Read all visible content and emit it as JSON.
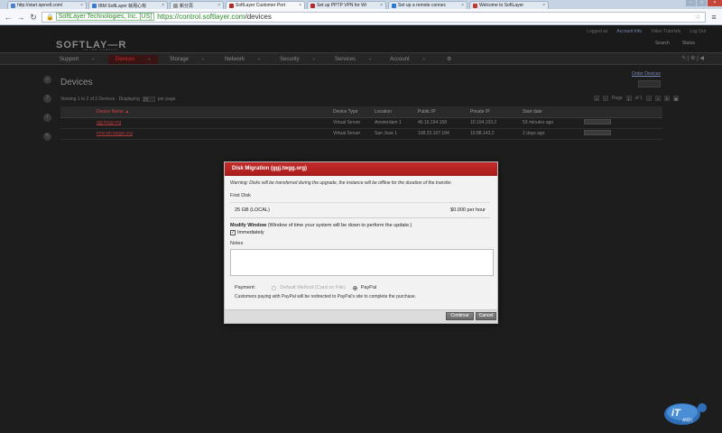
{
  "browser": {
    "tabs": [
      {
        "label": "http://start.iqonell.com/",
        "color": "#4f7fcf",
        "active": false
      },
      {
        "label": "IBM SoftLayer 就甩心有",
        "color": "#3d7cc9",
        "active": false
      },
      {
        "label": "新分頁",
        "color": "#999999",
        "active": false
      },
      {
        "label": "SoftLayer Customer Port",
        "color": "#b32a2a",
        "active": true
      },
      {
        "label": "Set up PPTP VPN for Wi",
        "color": "#b32a2a",
        "active": false
      },
      {
        "label": "Set up a remote connec",
        "color": "#2c7ad6",
        "active": false
      },
      {
        "label": "Welcome to SoftLayer",
        "color": "#c0392b",
        "active": false
      }
    ],
    "site_identity": "SoftLayer Technologies, Inc. [US]",
    "url_host": "https://control.softlayer.com",
    "url_path": "/devices"
  },
  "header": {
    "logo": "SOFTLAY—R",
    "logo_sub": "AN IBM COMPANY",
    "top_links": [
      "Logged as",
      "Account Info",
      "Video Tutorials",
      "Log Out"
    ],
    "top_buttons": [
      "Search",
      "Status"
    ],
    "nav": [
      {
        "label": "Support",
        "active": false
      },
      {
        "label": "Devices",
        "active": true
      },
      {
        "label": "Storage",
        "active": false
      },
      {
        "label": "Network",
        "active": false
      },
      {
        "label": "Security",
        "active": false
      },
      {
        "label": "Services",
        "active": false
      },
      {
        "label": "Account",
        "active": false
      }
    ],
    "nav_right": "✎ | ⚙ | ◀"
  },
  "page": {
    "title": "Devices",
    "order_link": "Order Devices",
    "pager_text": "Viewing 1 to 2 of 2 Devices · Displaying",
    "per_page_value": "25",
    "per_page_label": "per page",
    "page_label": "Page",
    "page_current": "1",
    "page_of": "of 1",
    "columns": [
      "Device Name ▲",
      "Device Type",
      "Location",
      "Public IP",
      "Private IP",
      "Start date",
      ""
    ],
    "rows": [
      [
        "ggj.twgg.org",
        "Virtual Server",
        "Amsterdam 1",
        "46.16.194.168",
        "10.104.103.2",
        "53 minutes ago",
        ""
      ],
      [
        "ironrain.twggs.org",
        "Virtual Server",
        "San Jose 1",
        "108.23.107.184",
        "10.88.143.2",
        "2 days ago",
        ""
      ]
    ]
  },
  "modal": {
    "title": "Disk Migration (ggj.twgg.org)",
    "warning": "Warning: Disks will be transferred during the upgrade, the instance will be offline for the duration of the transfer.",
    "first_disk_label": "First Disk",
    "disk_size": "25 GB (LOCAL)",
    "disk_price": "$0.000 per hour",
    "modify_label": "Modify Window",
    "modify_note": "(Window of time your system will be down to perform the update.)",
    "immediately_label": "Immediately",
    "immediately_checked": true,
    "notes_label": "Notes",
    "notes_value": "",
    "payment_label": "Payment:",
    "payment_option_default": "Default Method (Card on File)",
    "payment_option_paypal": "PayPal",
    "paypal_note": "Customers paying with PayPal will be redirected to PayPal's site to complete the purchase.",
    "continue_label": "Continue",
    "cancel_label": "Cancel"
  },
  "badge": {
    "text": "iT",
    "subtext": "邦幫忙"
  }
}
